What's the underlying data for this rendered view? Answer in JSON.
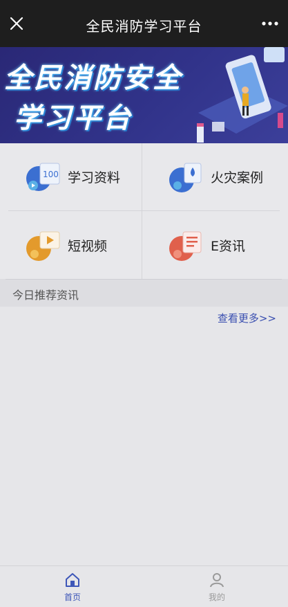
{
  "header": {
    "title": "全民消防学习平台",
    "close_icon": "close-icon",
    "more_icon": "more-icon"
  },
  "banner": {
    "line1": "全民消防安全",
    "line2": "学习平台"
  },
  "menu": [
    {
      "label": "学习资料",
      "icon": "study-material-icon",
      "color": "#3b6fd1"
    },
    {
      "label": "火灾案例",
      "icon": "fire-case-icon",
      "color": "#3b6fd1"
    },
    {
      "label": "短视频",
      "icon": "short-video-icon",
      "color": "#e39a2c"
    },
    {
      "label": "E资讯",
      "icon": "e-news-icon",
      "color": "#e0604c"
    }
  ],
  "section": {
    "title": "今日推荐资讯",
    "more": "查看更多>>"
  },
  "tabbar": {
    "items": [
      {
        "label": "首页",
        "icon": "home-icon",
        "active": true
      },
      {
        "label": "我的",
        "icon": "user-icon",
        "active": false
      }
    ]
  },
  "colors": {
    "accent": "#3d56b8",
    "topbar": "#1e1e1e",
    "banner": "#2e2f84"
  }
}
